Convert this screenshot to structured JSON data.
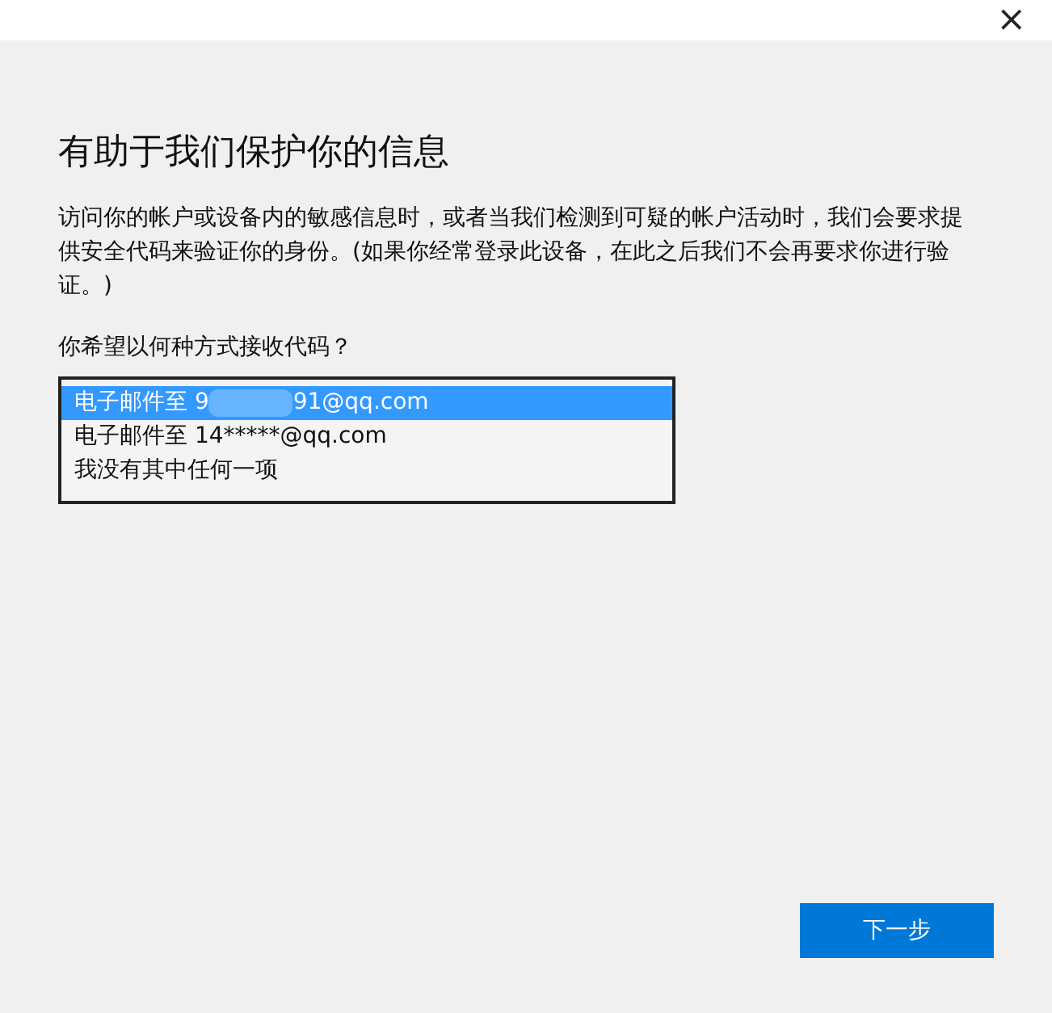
{
  "window": {
    "close_glyph": "×"
  },
  "heading": "有助于我们保护你的信息",
  "description": "访问你的帐户或设备内的敏感信息时，或者当我们检测到可疑的帐户活动时，我们会要求提供安全代码来验证你的身份。(如果你经常登录此设备，在此之后我们不会再要求你进行验证。)",
  "question": "你希望以何种方式接收代码？",
  "options": [
    {
      "text": "电子邮件至 9",
      "masked": true,
      "text_after": "91@qq.com",
      "selected": true
    },
    {
      "text": "电子邮件至 14*****@qq.com",
      "masked": false,
      "selected": false
    },
    {
      "text": "我没有其中任何一项",
      "masked": false,
      "selected": false
    }
  ],
  "next_button": "下一步"
}
